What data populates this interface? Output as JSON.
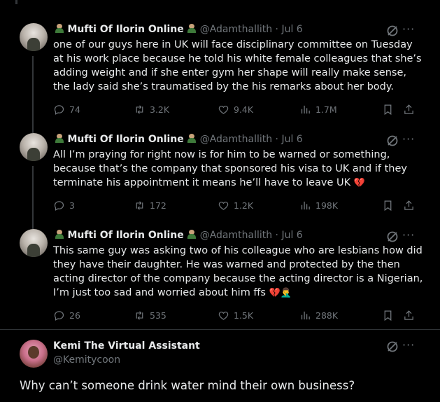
{
  "tweets": [
    {
      "name": "Mufti Of Ilorin Online",
      "handle": "@Adamthallith",
      "date": "Jul 6",
      "text": "one of our guys here in UK will face disciplinary committee on Tuesday at his work place because he told his white female colleagues that she’s adding weight and if she enter gym her shape will really make sense, the lady said she’s traumatised by the  his remarks about her body.",
      "replies": "74",
      "retweets": "3.2K",
      "likes": "9.4K",
      "views": "1.7M"
    },
    {
      "name": "Mufti Of Ilorin Online",
      "handle": "@Adamthallith",
      "date": "Jul 6",
      "text": "All I’m praying for right now is for him to be warned or something, because that’s the company that sponsored his visa to UK and if they terminate his appointment it means he’ll have to leave UK",
      "emoji_tail": "💔",
      "replies": "3",
      "retweets": "172",
      "likes": "1.2K",
      "views": "198K"
    },
    {
      "name": "Mufti Of Ilorin Online",
      "handle": "@Adamthallith",
      "date": "Jul 6",
      "text": "This same guy was asking two of his colleague who are lesbians how did they have their daughter. He was warned and protected by the then acting director of the company because the acting director is a Nigerian, I’m just too sad and worried about him ffs",
      "emoji_tail": "💔🤦‍♂️",
      "replies": "26",
      "retweets": "535",
      "likes": "1.5K",
      "views": "288K"
    }
  ],
  "reply": {
    "name": "Kemi The Virtual Assistant",
    "handle": "@Kemitycoon",
    "text": "Why can’t someone drink water mind their own business?"
  },
  "separator": " · ",
  "more_label": "···",
  "colors": {
    "bg": "#000000",
    "text": "#e7e9ea",
    "muted": "#71767b",
    "rail": "#333639",
    "heart": "#f4212e"
  },
  "icons": [
    "reply-icon",
    "retweet-icon",
    "like-icon",
    "views-icon",
    "bookmark-icon",
    "share-icon",
    "grok-icon",
    "more-icon"
  ]
}
